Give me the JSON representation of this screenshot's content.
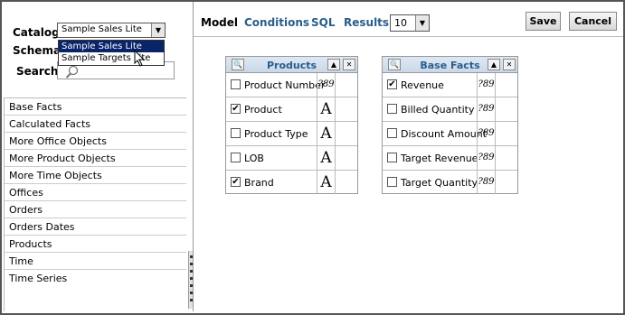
{
  "left_panel": {
    "catalog_label": "Catalog",
    "catalog_value": "Sample Sales Lite",
    "catalog_options": [
      "Sample Sales Lite",
      "Sample Targets Lite"
    ],
    "schema_label": "Schema",
    "search_label": "Search",
    "subject_areas": [
      "Base Facts",
      "Calculated Facts",
      "More Office Objects",
      "More Product Objects",
      "More Time Objects",
      "Offices",
      "Orders",
      "Orders Dates",
      "Products",
      "Time",
      "Time Series"
    ]
  },
  "toolbar": {
    "tabs": [
      "Model",
      "Conditions",
      "SQL",
      "Results"
    ],
    "rows_value": "10",
    "save_label": "Save",
    "cancel_label": "Cancel"
  },
  "tables": [
    {
      "title": "Products",
      "columns": [
        {
          "name": "Product Number",
          "checked": false,
          "type": "numeric"
        },
        {
          "name": "Product",
          "checked": true,
          "type": "text"
        },
        {
          "name": "Product Type",
          "checked": false,
          "type": "text"
        },
        {
          "name": "LOB",
          "checked": false,
          "type": "text"
        },
        {
          "name": "Brand",
          "checked": true,
          "type": "text"
        }
      ]
    },
    {
      "title": "Base Facts",
      "columns": [
        {
          "name": "Revenue",
          "checked": true,
          "type": "numeric"
        },
        {
          "name": "Billed Quantity",
          "checked": false,
          "type": "numeric"
        },
        {
          "name": "Discount Amount",
          "checked": false,
          "type": "numeric"
        },
        {
          "name": "Target Revenue",
          "checked": false,
          "type": "numeric"
        },
        {
          "name": "Target Quantity",
          "checked": false,
          "type": "numeric"
        }
      ]
    }
  ],
  "glyphs": {
    "text_type": "A",
    "numeric_type": "?89",
    "checkmark": "✔",
    "dropdown_arrow": "▼",
    "collapse_icon": "▲",
    "close_icon": "✕"
  }
}
